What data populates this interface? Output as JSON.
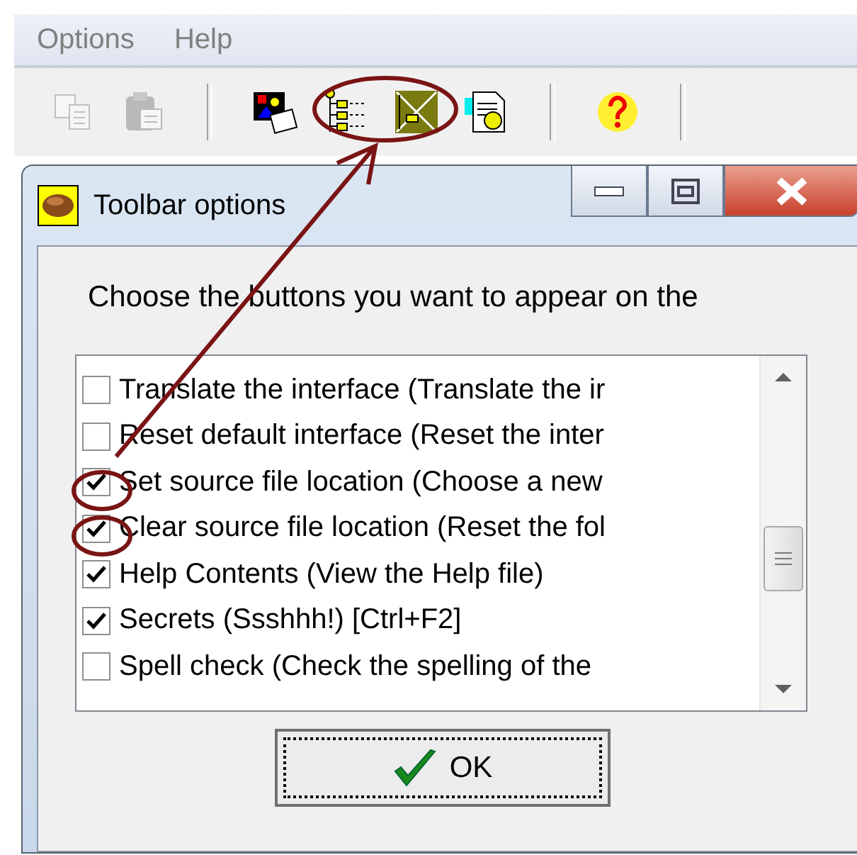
{
  "menu": [
    "Options",
    "Help"
  ],
  "toolbar": [
    {
      "kind": "copy",
      "disabled": true
    },
    {
      "kind": "paste",
      "disabled": true
    },
    {
      "kind": "sep"
    },
    {
      "kind": "pictures",
      "disabled": false
    },
    {
      "kind": "tree",
      "disabled": false
    },
    {
      "kind": "clear",
      "disabled": false
    },
    {
      "kind": "document",
      "disabled": false
    },
    {
      "kind": "sep"
    },
    {
      "kind": "help",
      "disabled": false
    },
    {
      "kind": "sep"
    }
  ],
  "dialog": {
    "title": "Toolbar options",
    "prompt": "Choose the buttons you want to appear on the",
    "items": [
      {
        "label": "Translate the interface (Translate the ir",
        "checked": false
      },
      {
        "label": "Reset default interface (Reset the inter",
        "checked": false
      },
      {
        "label": "Set source file location (Choose a new",
        "checked": true
      },
      {
        "label": "Clear source file location (Reset the fol",
        "checked": true
      },
      {
        "label": "Help Contents (View the Help file)",
        "checked": true
      },
      {
        "label": "Secrets (Ssshhh!) [Ctrl+F2]",
        "checked": true
      },
      {
        "label": "Spell check (Check the spelling of the",
        "checked": false
      }
    ],
    "ok_button": "OK"
  }
}
